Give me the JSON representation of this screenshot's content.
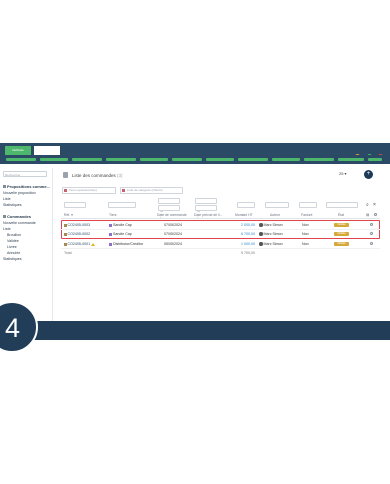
{
  "app": {
    "brand": "NetSuite"
  },
  "colors": {
    "primary": "#2a4a66",
    "accent": "#4db86b",
    "alert": "#e0444e",
    "status": "#d6a83a"
  },
  "sidebar": {
    "search_placeholder": "Rechercher",
    "sections": [
      {
        "label": "Propositions comme...",
        "items": [
          "Nouvelle proposition",
          "Liste",
          "Statistiques"
        ]
      },
      {
        "label": "Commandes",
        "items": [
          "Nouvelle commande",
          "Liste",
          "Brouillon",
          "Validée",
          "Livrée",
          "Annulée",
          "Statistiques"
        ]
      }
    ]
  },
  "page": {
    "title": "Liste des commandes",
    "count": "(3)",
    "per_page": "25 ▾",
    "add_icon": "plus-circle-icon"
  },
  "filters": {
    "user_placeholder": "Tiers représentant(e)",
    "category_placeholder": "Liste de catégorie (Clients)",
    "date_from": "De",
    "date_to": "À",
    "date_from2": "De",
    "date_to2": "À"
  },
  "table": {
    "headers": [
      "Réf. ▾",
      "Tiers",
      "Date de commande",
      "Date prévue de li...",
      "Montant HT",
      "Auteur",
      "Facturé",
      "État"
    ],
    "rows": [
      {
        "ref": "CO2405-0003",
        "warning": false,
        "client": "Sandie Cap",
        "date": "07/05/2024",
        "amount": "2 000,00",
        "author": "Marc Simon",
        "billed": "Non",
        "status": "Validée"
      },
      {
        "ref": "CO2405-0002",
        "warning": false,
        "client": "Sandie Cap",
        "date": "07/05/2024",
        "amount": "6 700,00",
        "author": "Marc Simon",
        "billed": "Non",
        "status": "Validée"
      },
      {
        "ref": "CO2405-0001",
        "warning": true,
        "client": "Distributor/Creditor",
        "date": "05/05/2024",
        "amount": "1 000,00",
        "author": "Marc Simon",
        "billed": "Non",
        "status": "Validée"
      }
    ],
    "total_label": "Total",
    "total_value": "9 700,00"
  },
  "step": {
    "number": "4"
  }
}
